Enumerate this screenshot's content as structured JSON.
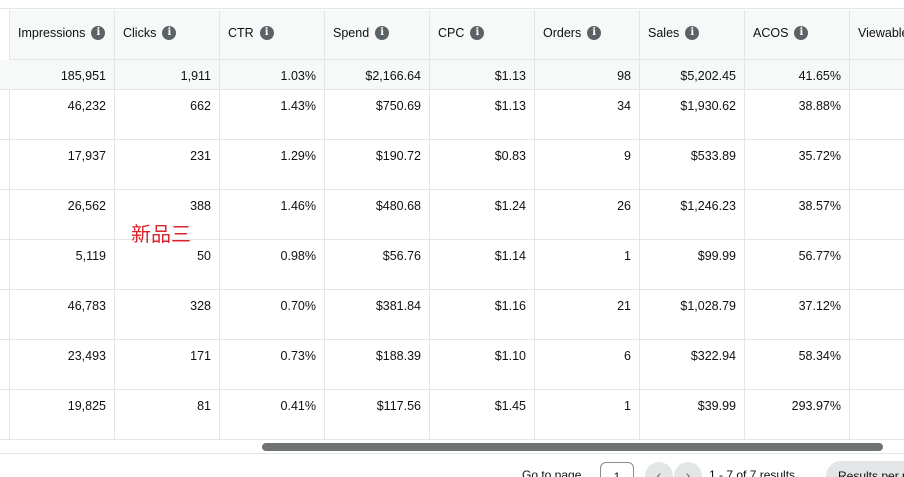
{
  "columns": [
    {
      "label": "Impressions",
      "info": true
    },
    {
      "label": "Clicks",
      "info": true
    },
    {
      "label": "CTR",
      "info": true
    },
    {
      "label": "Spend",
      "info": true
    },
    {
      "label": "CPC",
      "info": true
    },
    {
      "label": "Orders",
      "info": true
    },
    {
      "label": "Sales",
      "info": true
    },
    {
      "label": "ACOS",
      "info": true
    },
    {
      "label": "Viewable",
      "info": false
    }
  ],
  "summary": [
    "185,951",
    "1,911",
    "1.03%",
    "$2,166.64",
    "$1.13",
    "98",
    "$5,202.45",
    "41.65%",
    ""
  ],
  "rows": [
    [
      "46,232",
      "662",
      "1.43%",
      "$750.69",
      "$1.13",
      "34",
      "$1,930.62",
      "38.88%",
      ""
    ],
    [
      "17,937",
      "231",
      "1.29%",
      "$190.72",
      "$0.83",
      "9",
      "$533.89",
      "35.72%",
      ""
    ],
    [
      "26,562",
      "388",
      "1.46%",
      "$480.68",
      "$1.24",
      "26",
      "$1,246.23",
      "38.57%",
      ""
    ],
    [
      "5,119",
      "50",
      "0.98%",
      "$56.76",
      "$1.14",
      "1",
      "$99.99",
      "56.77%",
      ""
    ],
    [
      "46,783",
      "328",
      "0.70%",
      "$381.84",
      "$1.16",
      "21",
      "$1,028.79",
      "37.12%",
      ""
    ],
    [
      "23,493",
      "171",
      "0.73%",
      "$188.39",
      "$1.10",
      "6",
      "$322.94",
      "58.34%",
      ""
    ],
    [
      "19,825",
      "81",
      "0.41%",
      "$117.56",
      "$1.45",
      "1",
      "$39.99",
      "293.97%",
      ""
    ]
  ],
  "annotation": "新品三",
  "pagination": {
    "go_to_label": "Go to page",
    "page_value": "1",
    "prev_glyph": "‹",
    "next_glyph": "›",
    "range_text": "1 - 7 of 7 results",
    "results_per_page_label": "Results per page"
  },
  "icons": {
    "info": "info-icon",
    "prev": "chevron-left-icon",
    "next": "chevron-right-icon"
  },
  "colors": {
    "annotation": "#d9232d",
    "header_bg": "#f7f8f8",
    "border": "#e3e6e6",
    "scroll_thumb": "#6f7373"
  }
}
